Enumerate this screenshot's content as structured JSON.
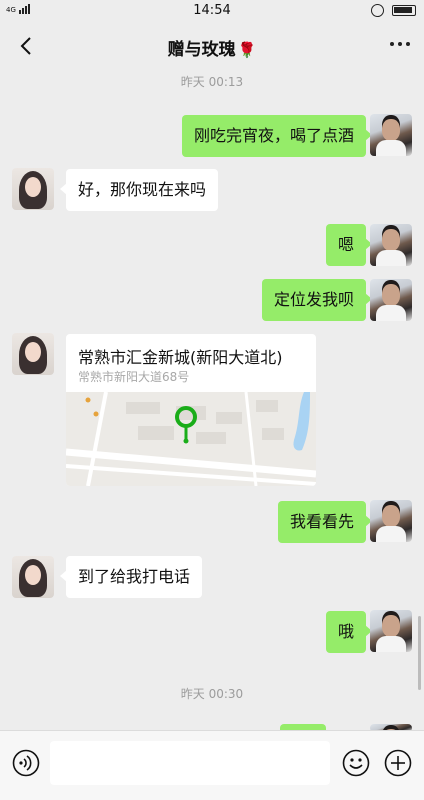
{
  "status_bar": {
    "network_label": "4G",
    "time": "14:54"
  },
  "header": {
    "title": "赠与玫瑰",
    "title_emoji": "🌹"
  },
  "messages": [
    {
      "type": "timestamp",
      "text": "昨天 00:13"
    },
    {
      "type": "text",
      "from": "me",
      "text": "刚吃完宵夜，喝了点酒"
    },
    {
      "type": "text",
      "from": "them",
      "text": "好，那你现在来吗"
    },
    {
      "type": "text",
      "from": "me",
      "text": "嗯"
    },
    {
      "type": "text",
      "from": "me",
      "text": "定位发我呗"
    },
    {
      "type": "location",
      "from": "them",
      "name": "常熟市汇金新城(新阳大道北)",
      "address": "常熟市新阳大道68号"
    },
    {
      "type": "text",
      "from": "me",
      "text": "我看看先"
    },
    {
      "type": "text",
      "from": "them",
      "text": "到了给我打电话"
    },
    {
      "type": "text",
      "from": "me",
      "text": "哦"
    },
    {
      "type": "timestamp",
      "text": "昨天 00:30"
    }
  ],
  "colors": {
    "background": "#ededed",
    "my_bubble": "#95ec69",
    "their_bubble": "#ffffff",
    "timestamp_text": "#9c9c9c"
  },
  "icons": {
    "back": "chevron-left-icon",
    "more": "more-dots-icon",
    "voice": "voice-icon",
    "emoji": "emoji-icon",
    "plus": "plus-icon"
  }
}
